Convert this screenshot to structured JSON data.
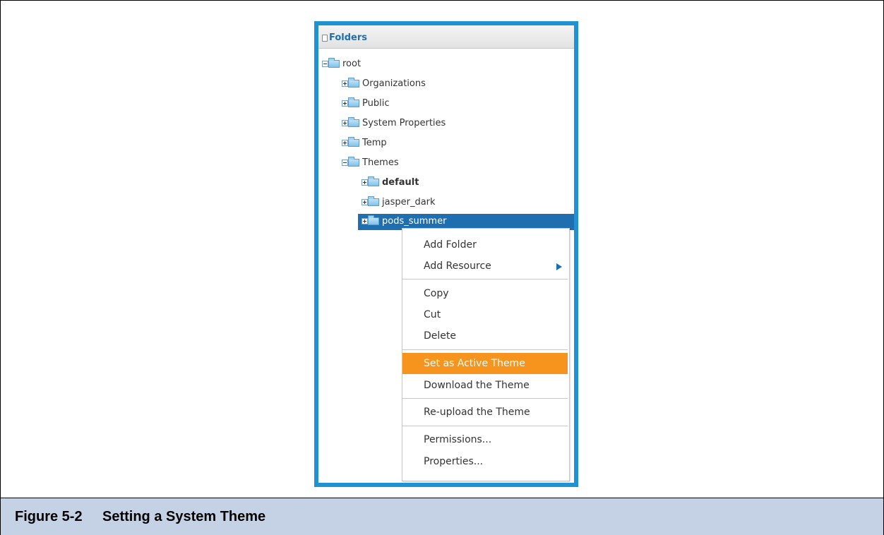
{
  "caption": {
    "number": "Figure 5-2",
    "title": "Setting a System Theme"
  },
  "panel": {
    "title": "Folders"
  },
  "tree": {
    "root": "root",
    "organizations": "Organizations",
    "public": "Public",
    "system_properties": "System Properties",
    "temp": "Temp",
    "themes": "Themes",
    "default": "default",
    "jasper_dark": "jasper_dark",
    "pods_summer": "pods_summer"
  },
  "context_menu": {
    "add_folder": "Add Folder",
    "add_resource": "Add Resource",
    "copy": "Copy",
    "cut": "Cut",
    "delete": "Delete",
    "set_active_theme": "Set as Active Theme",
    "download_theme": "Download the Theme",
    "reupload_theme": "Re-upload the Theme",
    "permissions": "Permissions...",
    "properties": "Properties..."
  },
  "colors": {
    "frame_border": "#1f92d2",
    "selection": "#1f6fb0",
    "menu_highlight": "#f7941d",
    "caption_bg": "#c5d1e4"
  }
}
